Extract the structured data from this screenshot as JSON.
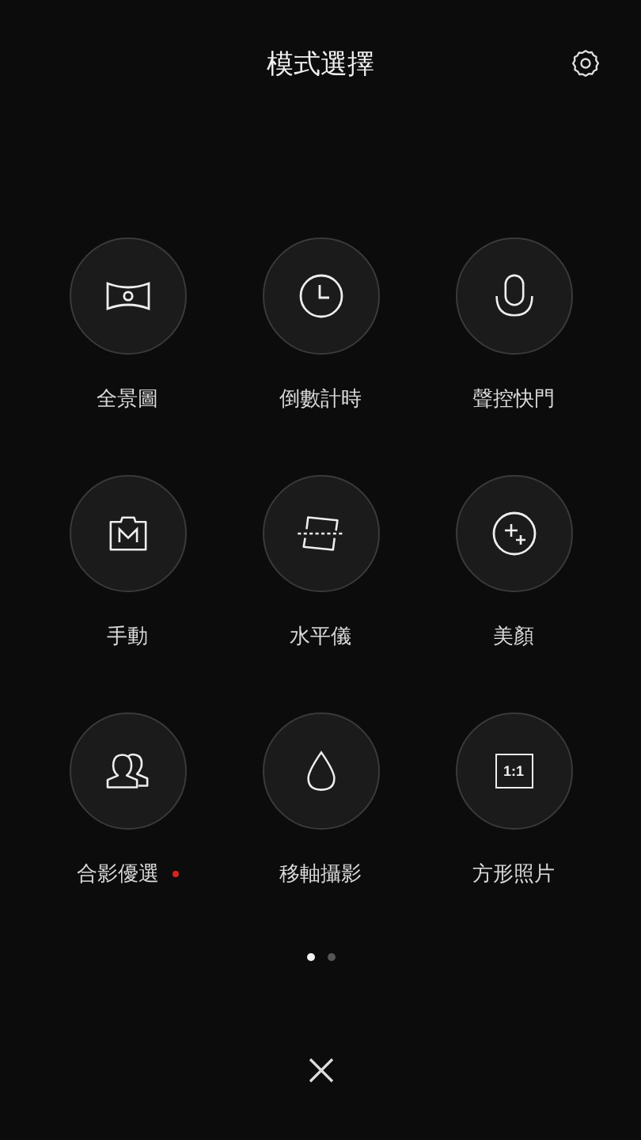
{
  "header": {
    "title": "模式選擇"
  },
  "modes": [
    {
      "kind": "panorama",
      "label": "全景圖",
      "badge": false
    },
    {
      "kind": "timer",
      "label": "倒數計時",
      "badge": false
    },
    {
      "kind": "voice",
      "label": "聲控快門",
      "badge": false
    },
    {
      "kind": "manual",
      "label": "手動",
      "badge": false
    },
    {
      "kind": "level",
      "label": "水平儀",
      "badge": false
    },
    {
      "kind": "beauty",
      "label": "美顏",
      "badge": false
    },
    {
      "kind": "group",
      "label": "合影優選",
      "badge": true
    },
    {
      "kind": "tiltshift",
      "label": "移軸攝影",
      "badge": false
    },
    {
      "kind": "square",
      "label": "方形照片",
      "badge": false,
      "icon_text": "1:1"
    }
  ],
  "pages": [
    {
      "selected": true
    },
    {
      "selected": false
    }
  ]
}
